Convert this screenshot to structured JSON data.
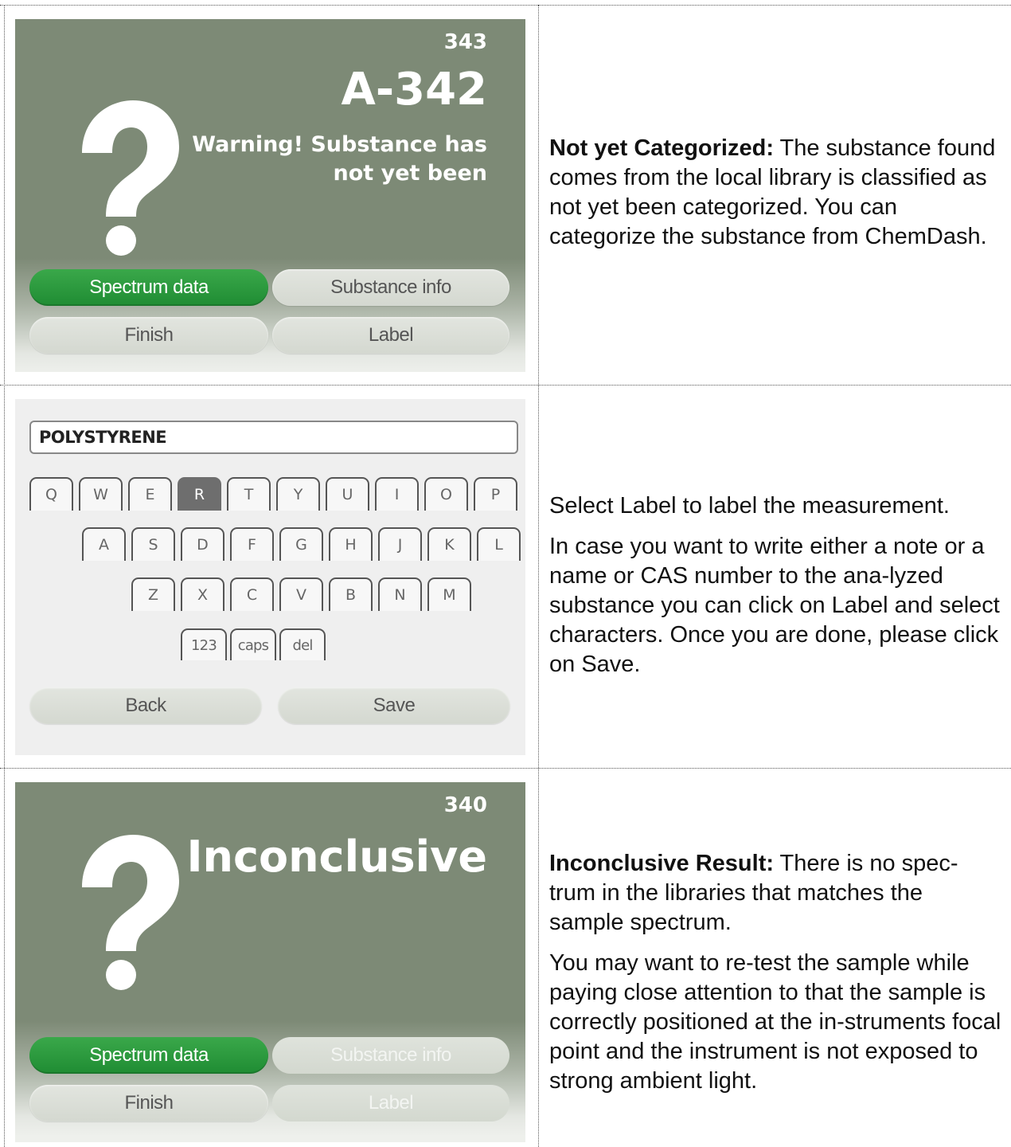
{
  "rows": [
    {
      "screen": {
        "number": "343",
        "code": "A-342",
        "warning_line1": "Warning! Substance has",
        "warning_line2": "not yet been",
        "buttons": {
          "spectrum": "Spectrum data",
          "substance": "Substance info",
          "finish": "Finish",
          "label": "Label"
        }
      },
      "description": {
        "heading": "Not yet Categorized:",
        "text": " The substance found comes from the local library is classified as not yet been categorized. You can categorize the substance from ChemDash."
      }
    },
    {
      "screen": {
        "input_value": "POLYSTYRENE",
        "keys_row1": [
          "Q",
          "W",
          "E",
          "R",
          "T",
          "Y",
          "U",
          "I",
          "O",
          "P"
        ],
        "keys_row2": [
          "A",
          "S",
          "D",
          "F",
          "G",
          "H",
          "J",
          "K",
          "L"
        ],
        "keys_row3": [
          "Z",
          "X",
          "C",
          "V",
          "B",
          "N",
          "M"
        ],
        "keys_fn": [
          "123",
          "caps",
          "del"
        ],
        "pressed_key": "R",
        "buttons": {
          "back": "Back",
          "save": "Save"
        }
      },
      "description": {
        "para1": "Select Label to label the measurement.",
        "para2": "In case you want to write either a note or a name or CAS number to the ana-lyzed substance you can click on Label and select characters. Once you are done, please click on Save."
      }
    },
    {
      "screen": {
        "number": "340",
        "title": "Inconclusive",
        "buttons": {
          "spectrum": "Spectrum data",
          "substance": "Substance info",
          "finish": "Finish",
          "label": "Label"
        }
      },
      "description": {
        "heading": "Inconclusive Result:",
        "text": " There is no spec-trum in the libraries that matches the sample spectrum.",
        "para2": "You may want to re-test the sample while paying close attention to that the sample is correctly positioned at the in-struments focal point and the instrument is not exposed to strong ambient light."
      }
    }
  ],
  "colors": {
    "screen_bg": "#7d8a76",
    "active_button": "#2a9a3c",
    "inactive_button": "#dcdfd8",
    "pressed_key": "#6e6e6e"
  }
}
